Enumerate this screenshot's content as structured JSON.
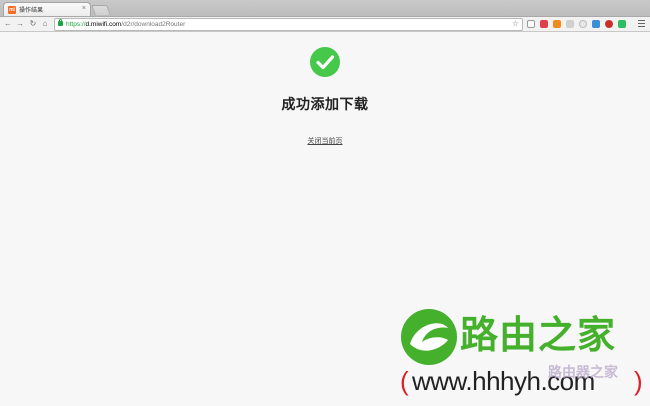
{
  "browser": {
    "tab": {
      "favicon_text": "mi",
      "title": "操作结果",
      "close": "×"
    },
    "nav": {
      "back": "←",
      "forward": "→",
      "reload": "↻",
      "home": "⌂"
    },
    "url": {
      "scheme": "https://",
      "host": "d.miwifi.com",
      "path": "/d2r/download2Router"
    },
    "bookmark_icon": "star-icon",
    "extensions": [
      "pocket-icon",
      "rss-icon",
      "translate-icon",
      "extension-icon",
      "clock-icon",
      "screen-icon",
      "adblock-icon",
      "evernote-icon"
    ]
  },
  "page": {
    "status_icon": "check-circle-icon",
    "status_color": "#46c84a",
    "title": "成功添加下载",
    "close_link": "关闭当前页"
  },
  "watermark": {
    "brand": "路由之家",
    "url": "www.hhhyh.com",
    "paren_left": "(",
    "paren_right": ")",
    "sub": "路由器之家",
    "colors": {
      "brand": "#44b02c",
      "paren": "#d9232a"
    }
  }
}
